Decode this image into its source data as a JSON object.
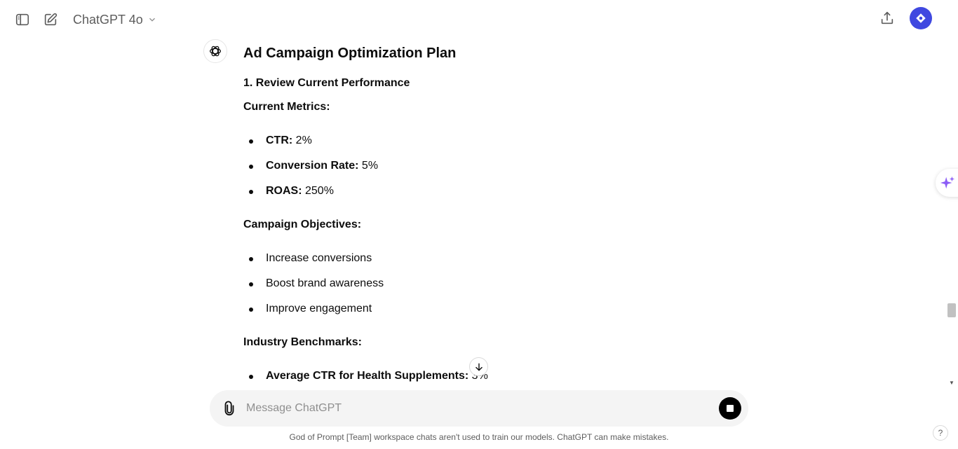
{
  "header": {
    "model_name": "ChatGPT 4o"
  },
  "message": {
    "title": "Ad Campaign Optimization Plan",
    "step_heading": "1. Review Current Performance",
    "sections": [
      {
        "heading": "Current Metrics:",
        "items": [
          {
            "label": "CTR:",
            "value": " 2%"
          },
          {
            "label": "Conversion Rate:",
            "value": " 5%"
          },
          {
            "label": "ROAS:",
            "value": " 250%"
          }
        ]
      },
      {
        "heading": "Campaign Objectives:",
        "items": [
          {
            "text": "Increase conversions"
          },
          {
            "text": "Boost brand awareness"
          },
          {
            "text": "Improve engagement"
          }
        ]
      },
      {
        "heading": "Industry Benchmarks:",
        "items": [
          {
            "label": "Average CTR for Health Supplements:",
            "value": " 3%"
          }
        ]
      }
    ]
  },
  "composer": {
    "placeholder": "Message ChatGPT"
  },
  "footer": {
    "disclaimer": "God of Prompt [Team] workspace chats aren't used to train our models. ChatGPT can make mistakes.",
    "help": "?"
  },
  "colors": {
    "avatar": "#3f48e0",
    "sparkle": "#8b5cf6"
  },
  "icons": [
    "sidebar-toggle-icon",
    "new-chat-icon",
    "chevron-down-icon",
    "share-icon",
    "openai-logo-icon",
    "sparkle-icon",
    "arrow-down-icon",
    "paperclip-icon",
    "stop-icon"
  ]
}
